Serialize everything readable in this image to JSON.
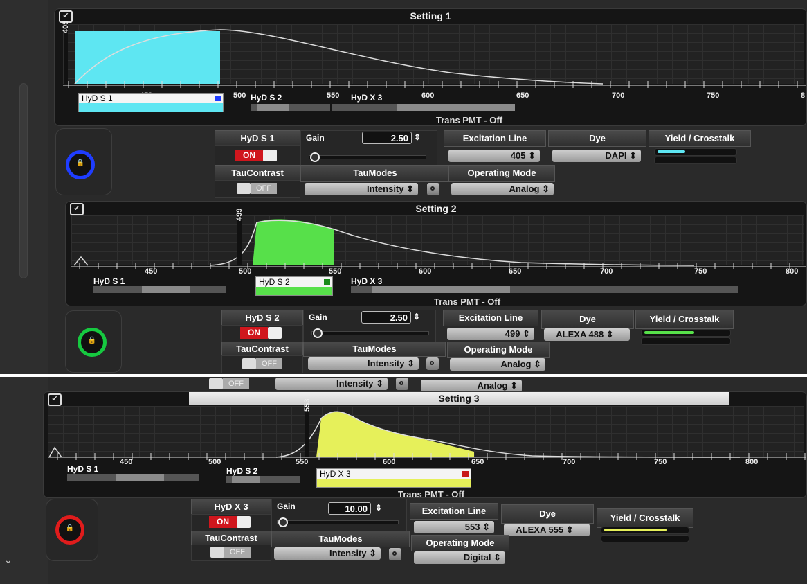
{
  "settings": [
    {
      "title": "Setting 1",
      "ticks": [
        "450",
        "500",
        "550",
        "600",
        "650",
        "700",
        "750",
        "8"
      ],
      "detectors": [
        "HyD S 1",
        "HyD S 2",
        "HyD X 3"
      ],
      "marker": "405",
      "trans": "Trans PMT - Off",
      "color": "#5ee6f2",
      "panel": {
        "detector": "HyD S 1",
        "state": "ON",
        "gain_label": "Gain",
        "gain": "2.50",
        "excitation_label": "Excitation Line",
        "excitation": "405",
        "dye_label": "Dye",
        "dye": "DAPI",
        "yield_label": "Yield / Crosstalk",
        "tau_contrast_label": "TauContrast",
        "tau_state": "OFF",
        "taumodes_label": "TauModes",
        "taumode": "Intensity",
        "opmode_label": "Operating Mode",
        "opmode": "Analog",
        "lock_color": "#1f3dff"
      }
    },
    {
      "title": "Setting 2",
      "ticks": [
        "450",
        "500",
        "550",
        "600",
        "650",
        "700",
        "750",
        "800"
      ],
      "detectors": [
        "HyD S 1",
        "HyD S 2",
        "HyD X 3"
      ],
      "marker": "499",
      "trans": "Trans PMT - Off",
      "color": "#57e04a",
      "panel": {
        "detector": "HyD S 2",
        "state": "ON",
        "gain_label": "Gain",
        "gain": "2.50",
        "excitation_label": "Excitation Line",
        "excitation": "499",
        "dye_label": "Dye",
        "dye": "ALEXA 488",
        "yield_label": "Yield / Crosstalk",
        "tau_contrast_label": "TauContrast",
        "tau_state": "OFF",
        "taumodes_label": "TauModes",
        "taumode": "Intensity",
        "opmode_label": "Operating Mode",
        "opmode": "Analog",
        "lock_color": "#16c940"
      }
    },
    {
      "title": "Setting 3",
      "ticks": [
        "450",
        "500",
        "550",
        "600",
        "650",
        "700",
        "750",
        "800"
      ],
      "detectors": [
        "HyD S 1",
        "HyD S 2",
        "HyD X 3"
      ],
      "marker": "553",
      "trans": "Trans PMT - Off",
      "color": "#e6f05a",
      "panel": {
        "detector": "HyD X 3",
        "state": "ON",
        "gain_label": "Gain",
        "gain": "10.00",
        "excitation_label": "Excitation Line",
        "excitation": "553",
        "dye_label": "Dye",
        "dye": "ALEXA 555",
        "yield_label": "Yield / Crosstalk",
        "tau_contrast_label": "TauContrast",
        "tau_state": "OFF",
        "taumodes_label": "TauModes",
        "taumode": "Intensity",
        "opmode_label": "Operating Mode",
        "opmode": "Digital",
        "lock_color": "#e01c1c"
      }
    }
  ],
  "carry_over": {
    "tau_state": "OFF",
    "taumode": "Intensity",
    "opmode": "Analog"
  }
}
